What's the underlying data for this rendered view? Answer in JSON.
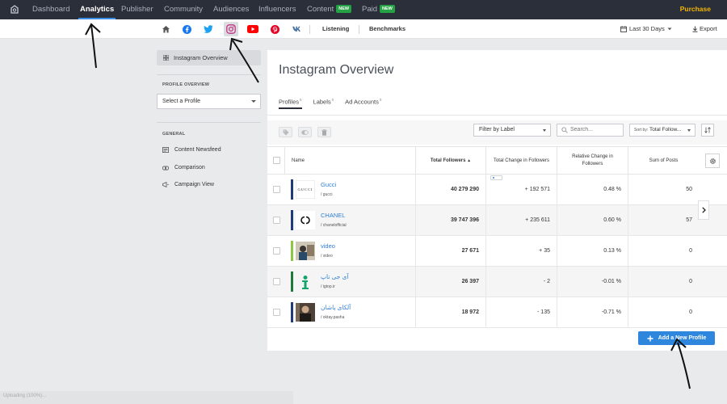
{
  "topnav": {
    "items": [
      {
        "label": "Dashboard",
        "new": false
      },
      {
        "label": "Analytics",
        "new": false
      },
      {
        "label": "Publisher",
        "new": false
      },
      {
        "label": "Community",
        "new": false
      },
      {
        "label": "Audiences",
        "new": false
      },
      {
        "label": "Influencers",
        "new": false
      },
      {
        "label": "Content",
        "new": true
      },
      {
        "label": "Paid",
        "new": true
      }
    ],
    "active": "Analytics",
    "new_badge": "NEW",
    "purchase": "Purchase"
  },
  "subnav": {
    "icons": [
      "home-icon",
      "facebook-icon",
      "twitter-icon",
      "instagram-icon",
      "youtube-icon",
      "pinterest-icon",
      "vk-icon"
    ],
    "active_icon": "instagram-icon",
    "listening": "Listening",
    "benchmarks": "Benchmarks",
    "date_range": "Last 30 Days",
    "export": "Export"
  },
  "sidebar": {
    "overview": "Instagram Overview",
    "profile_section": "PROFILE OVERVIEW",
    "select_profile": "Select a Profile",
    "general_section": "GENERAL",
    "links": [
      "Content Newsfeed",
      "Comparison",
      "Campaign View"
    ]
  },
  "main": {
    "title": "Instagram Overview",
    "tabs": [
      {
        "label": "Profiles",
        "count": "5"
      },
      {
        "label": "Labels",
        "count": "0"
      },
      {
        "label": "Ad Accounts",
        "count": "0"
      }
    ],
    "filter_label": "Filter by Label",
    "search_placeholder": "Search...",
    "sort_prefix": "Sort by:",
    "sort_value": "Total Follow...",
    "columns": [
      "Name",
      "Total Followers",
      "Total Change in Followers",
      "Relative Change in Followers",
      "Sum of Posts"
    ],
    "sorted_indicator": "▲",
    "rows": [
      {
        "name": "Gucci",
        "handle": "/ gucci",
        "total_followers": "40 279 290",
        "total_change": "+ 192 571",
        "relative_change": "0.48 %",
        "sum_posts": "50",
        "color": "#1f3b7a"
      },
      {
        "name": "CHANEL",
        "handle": "/ chanelofficial",
        "total_followers": "39 747 396",
        "total_change": "+ 235 611",
        "relative_change": "0.60 %",
        "sum_posts": "57",
        "color": "#1f3b7a"
      },
      {
        "name": "video",
        "handle": "/ video",
        "total_followers": "27 671",
        "total_change": "+ 35",
        "relative_change": "0.13 %",
        "sum_posts": "0",
        "color": "#8dc63f"
      },
      {
        "name": "آی جی تاپ",
        "handle": "/ igtop.ir",
        "total_followers": "26 397",
        "total_change": "- 2",
        "relative_change": "-0.01 %",
        "sum_posts": "0",
        "color": "#1e7a3a"
      },
      {
        "name": "آلکای پاشان",
        "handle": "/ oktay.pasha",
        "total_followers": "18 972",
        "total_change": "- 135",
        "relative_change": "-0.71 %",
        "sum_posts": "0",
        "color": "#1f3b7a"
      }
    ],
    "add_button": "Add a New Profile"
  },
  "status": "Uploading (100%)...",
  "colors": {
    "accent": "#2f86dd",
    "topnav_bg": "#2b2f3a",
    "purchase": "#f0b400",
    "new_badge": "#25a244",
    "instagram": "#c13584"
  }
}
